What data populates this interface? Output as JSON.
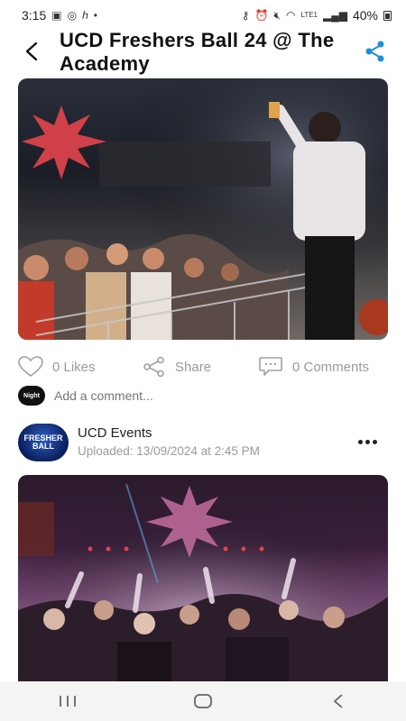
{
  "status_bar": {
    "time": "3:15",
    "battery_percent": "40%",
    "network_label": "LTE1"
  },
  "header": {
    "title": "UCD Freshers Ball 24 @ The Academy"
  },
  "post_1": {
    "likes_label": "0 Likes",
    "share_label": "Share",
    "comments_label": "0 Comments"
  },
  "comment_box": {
    "placeholder": "Add a comment...",
    "avatar_text": "Night"
  },
  "post_2": {
    "author": "UCD Events",
    "uploaded": "Uploaded: 13/09/2024 at 2:45 PM",
    "avatar_lines": [
      "FRESHER",
      "BALL"
    ]
  },
  "colors": {
    "accent": "#1f8fd6",
    "muted": "#9a9a9a",
    "star": "#e0434c"
  }
}
